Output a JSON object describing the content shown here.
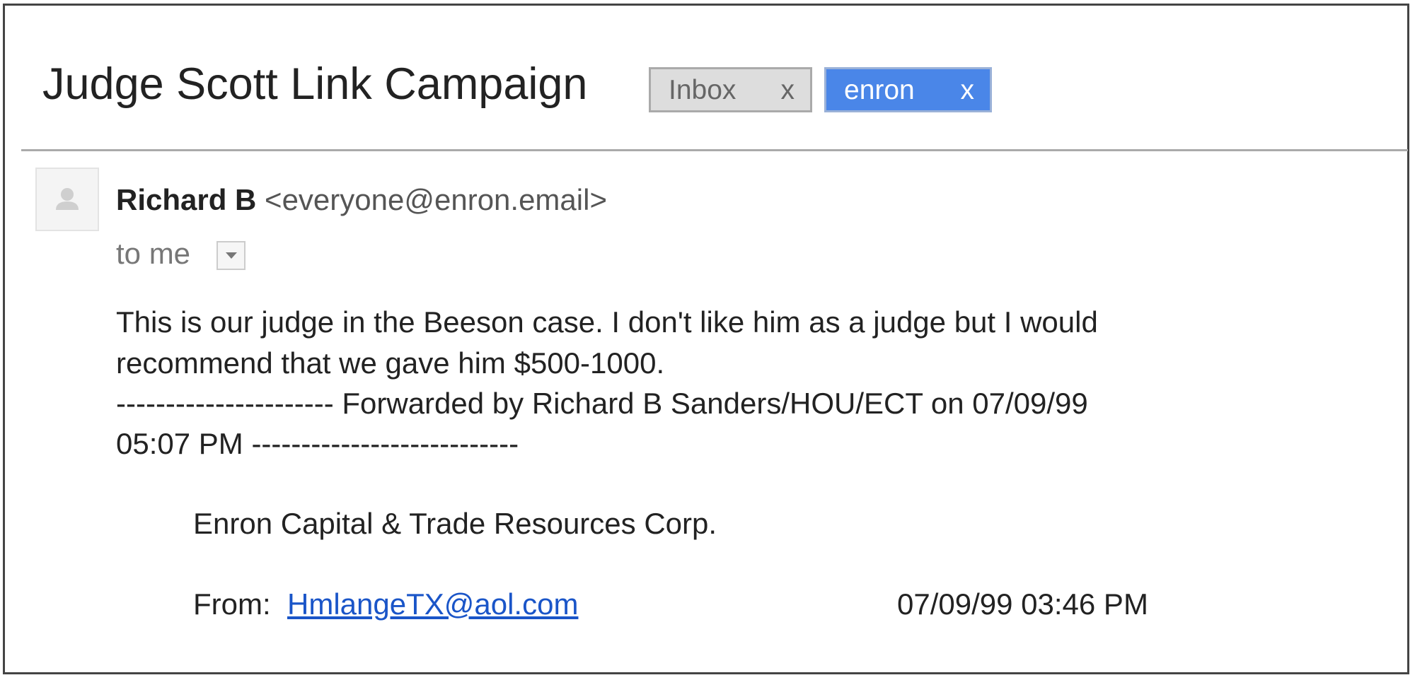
{
  "message": {
    "subject": "Judge Scott Link Campaign",
    "labels": [
      {
        "text": "Inbox",
        "remove": "x",
        "color": "#dddddd"
      },
      {
        "text": "enron",
        "remove": "x",
        "color": "#4a86e8"
      }
    ],
    "sender": {
      "name": "Richard B",
      "email": "<everyone@enron.email>",
      "avatar_icon": "person-icon"
    },
    "recipient": "to me",
    "body": {
      "lines": [
        "This is our judge in the Beeson case. I don't like him as a judge but I would",
        "recommend that we gave him $500-1000.",
        "---------------------- Forwarded by Richard B Sanders/HOU/ECT on 07/09/99",
        "05:07 PM ---------------------------"
      ],
      "company": "Enron Capital & Trade Resources Corp.",
      "from_label": "From:",
      "from_address": "HmlangeTX@aol.com",
      "from_date": "07/09/99 03:46 PM"
    }
  }
}
